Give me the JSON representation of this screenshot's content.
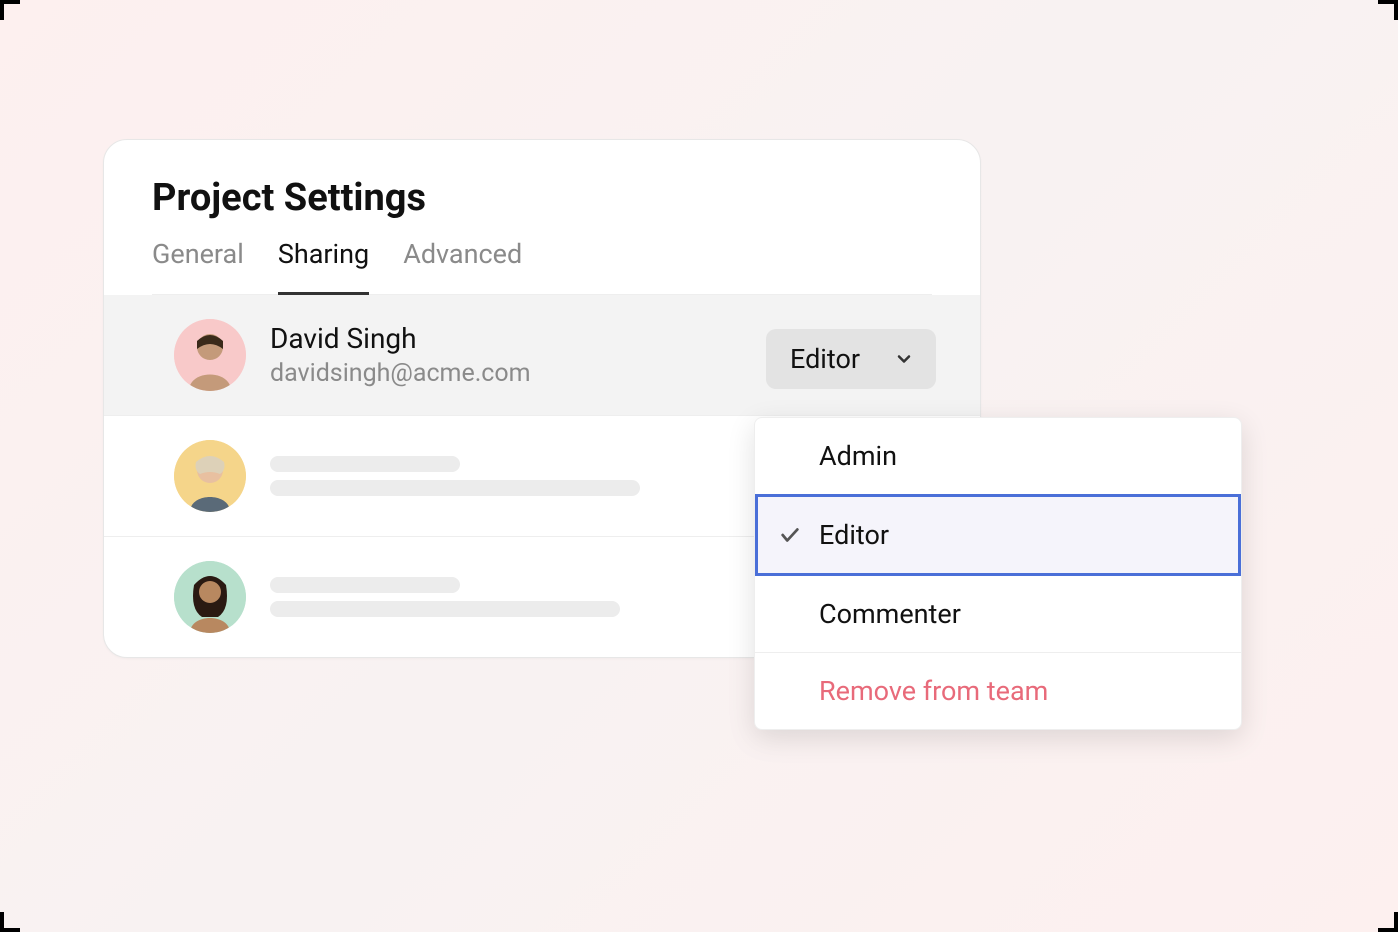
{
  "title": "Project Settings",
  "tabs": [
    {
      "label": "General",
      "active": false
    },
    {
      "label": "Sharing",
      "active": true
    },
    {
      "label": "Advanced",
      "active": false
    }
  ],
  "user": {
    "name": "David Singh",
    "email": "davidsingh@acme.com",
    "role": "Editor",
    "avatar_bg": "#f8c9c9"
  },
  "placeholder_users": [
    {
      "avatar_bg": "#f5d58a"
    },
    {
      "avatar_bg": "#b7e0cc"
    }
  ],
  "dropdown": {
    "options": [
      {
        "label": "Admin",
        "selected": false
      },
      {
        "label": "Editor",
        "selected": true
      },
      {
        "label": "Commenter",
        "selected": false
      }
    ],
    "remove_label": "Remove from team"
  }
}
